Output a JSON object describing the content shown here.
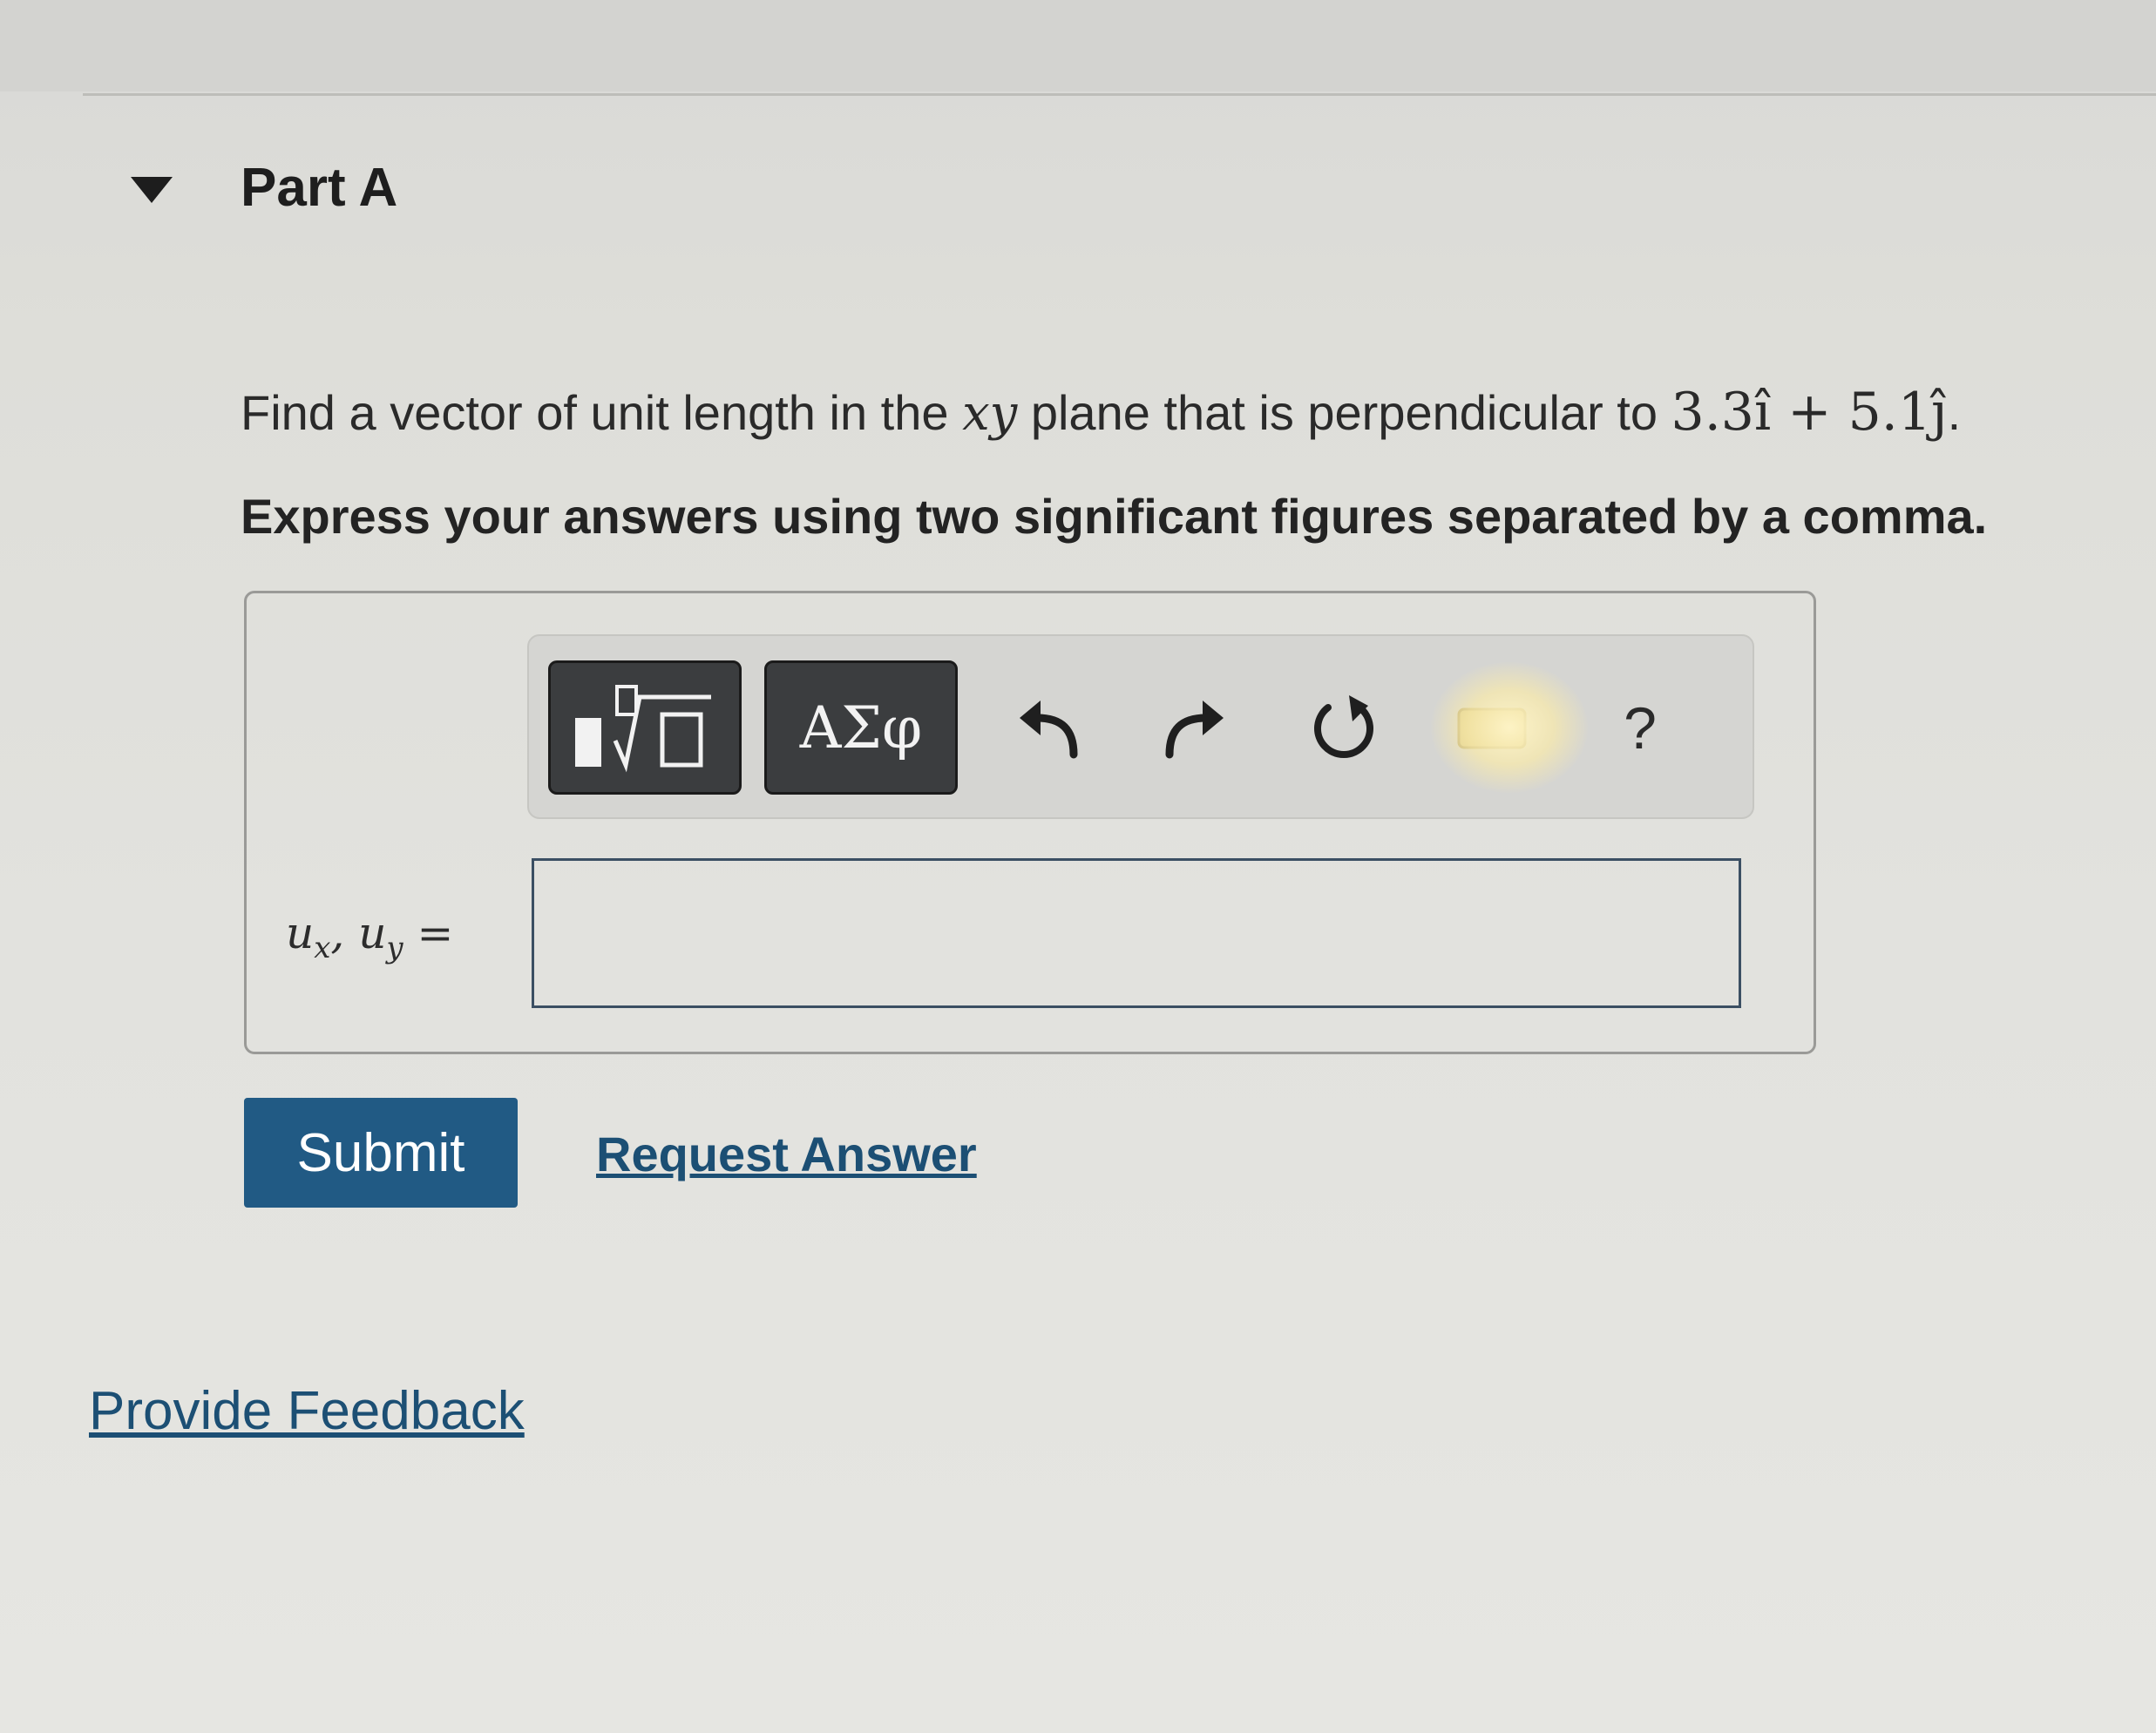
{
  "part": {
    "title": "Part A",
    "collapse_icon": "caret-down-icon"
  },
  "question": {
    "text_before": "Find a vector of unit length in the ",
    "variable": "xy",
    "text_middle": " plane that is perpendicular to ",
    "expression": "3.3î + 5.1ĵ",
    "text_after": ".",
    "instruction": "Express your answers using two significant figures separated by a comma."
  },
  "toolbar": {
    "templates_icon": "templates-sqrt-icon",
    "symbols_label": "ΑΣφ",
    "undo_icon": "undo-icon",
    "redo_icon": "redo-icon",
    "reset_icon": "reset-icon",
    "keyboard_icon": "keyboard-icon",
    "help_label": "?"
  },
  "answer": {
    "label_u1": "u",
    "label_sub1": "x",
    "label_sep": ", ",
    "label_u2": "u",
    "label_sub2": "y",
    "label_eq": " =",
    "value": ""
  },
  "actions": {
    "submit_label": "Submit",
    "request_answer_label": "Request Answer",
    "feedback_label": "Provide Feedback"
  },
  "colors": {
    "submit_bg": "#215a84",
    "link": "#1c4f74",
    "toolbar_dark": "#3b3d3f"
  }
}
